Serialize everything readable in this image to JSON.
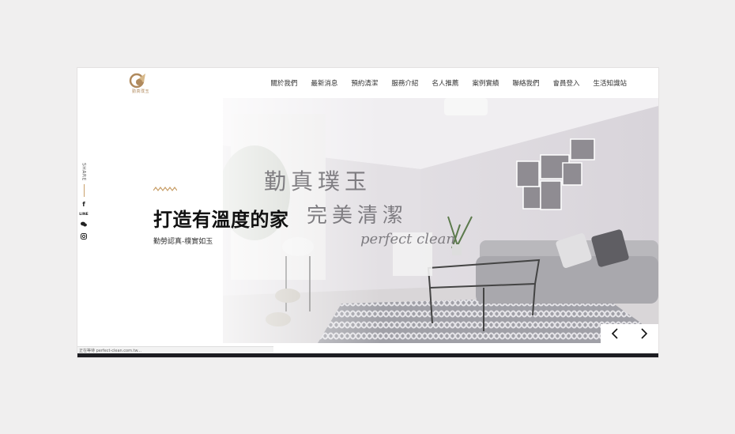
{
  "logo": {
    "text": "勤真璞玉"
  },
  "nav": {
    "items": [
      "關於我們",
      "最新消息",
      "預約清潔",
      "服務介紹",
      "名人推薦",
      "案例實績",
      "聯絡我們",
      "會員登入",
      "生活知識站"
    ]
  },
  "share": {
    "label": "SHARE",
    "icons": [
      "facebook-icon",
      "line-icon",
      "wechat-icon",
      "instagram-icon"
    ],
    "line_text": "LINE"
  },
  "hero": {
    "headline": "打造有溫度的家",
    "subline": "勤勞認真-樸實如玉",
    "overlay_title": "勤真璞玉",
    "overlay_sub": "完美清潔",
    "overlay_en": "perfect clean"
  },
  "status_bar": {
    "text": "正在等待 perfect-clean.com.tw..."
  },
  "colors": {
    "accent": "#c9a06b",
    "text": "#111111"
  }
}
